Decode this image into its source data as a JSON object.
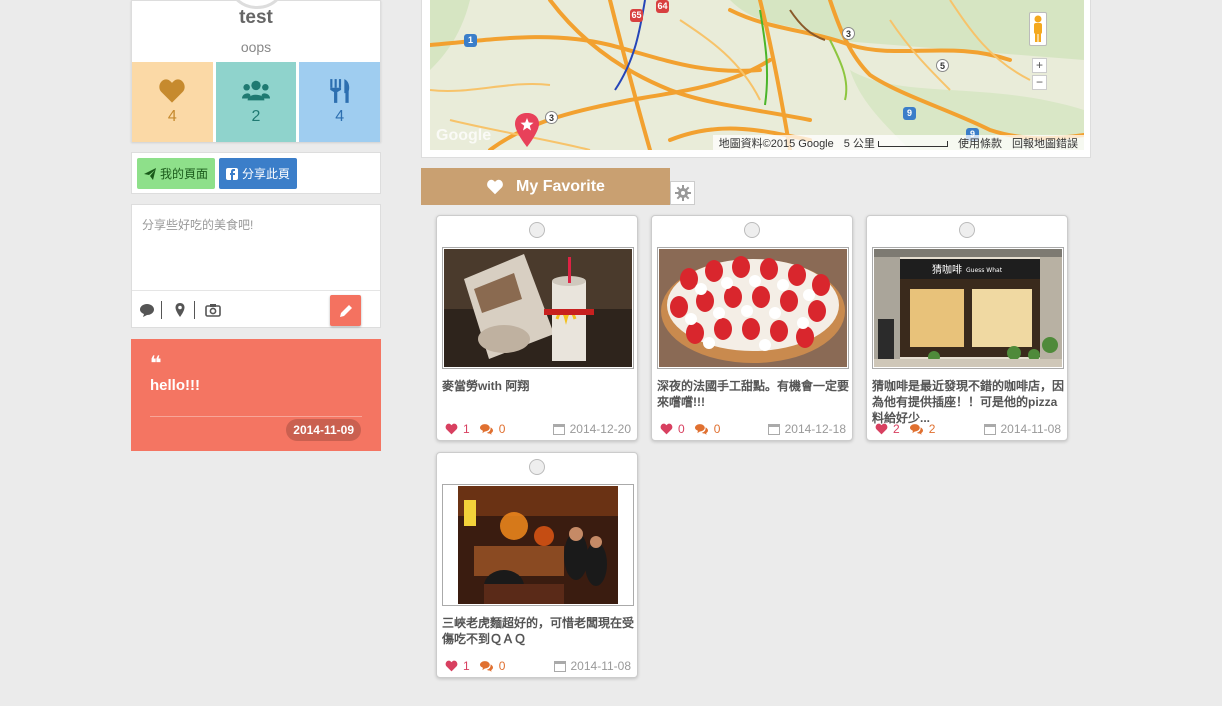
{
  "profile": {
    "name": "test",
    "subtitle": "oops",
    "stats": [
      {
        "icon": "heart-icon",
        "value": "4",
        "bg": "#fbd9a6",
        "color": "#c68a2e"
      },
      {
        "icon": "users-icon",
        "value": "2",
        "bg": "#8fd3cc",
        "color": "#1f7a72"
      },
      {
        "icon": "utensils-icon",
        "value": "4",
        "bg": "#9fcdf0",
        "color": "#2d6fb0"
      }
    ]
  },
  "share": {
    "my_page": "我的頁面",
    "share_page": "分享此頁"
  },
  "post": {
    "placeholder": "分享些好吃的美食吧!"
  },
  "quote": {
    "mark": "❝",
    "text": "hello!!!",
    "date": "2014-11-09"
  },
  "map": {
    "watermark": "Google",
    "attribution": "地圖資料©2015 Google",
    "scale": "5 公里",
    "terms": "使用條款",
    "report": "回報地圖錯誤",
    "zoom_in": "+",
    "zoom_out": "−",
    "badges": [
      "1",
      "65",
      "64",
      "3",
      "5",
      "3",
      "9",
      "9"
    ]
  },
  "favorite": {
    "title": "My Favorite"
  },
  "cards": [
    {
      "title": "麥當勞with 阿翔",
      "likes": "1",
      "comments": "0",
      "date": "2014-12-20"
    },
    {
      "title": "深夜的法國手工甜點。有機會一定要來嚐嚐!!!",
      "likes": "0",
      "comments": "0",
      "date": "2014-12-18"
    },
    {
      "title": "猜咖啡是最近發現不錯的咖啡店，因為他有提供插座！！可是他的pizza料給好少...",
      "likes": "2",
      "comments": "2",
      "date": "2014-11-08"
    },
    {
      "title": "三峽老虎麵超好的，可惜老闆現在受傷吃不到ＱＡＱ",
      "likes": "1",
      "comments": "0",
      "date": "2014-11-08"
    }
  ],
  "photo_texts": {
    "cafe_sign": "猜咖啡",
    "cafe_sub": "Guess What"
  }
}
